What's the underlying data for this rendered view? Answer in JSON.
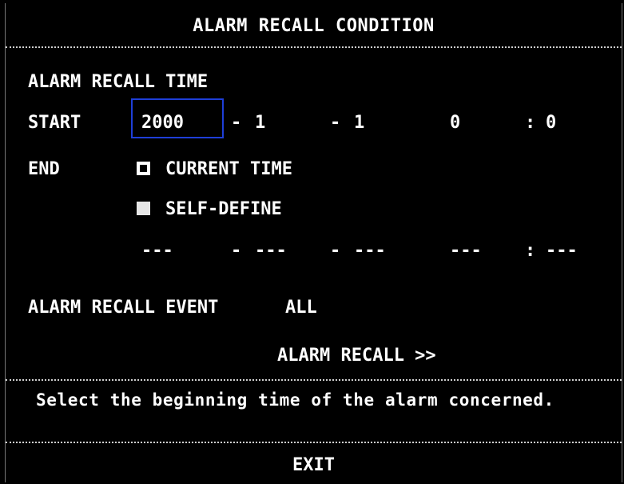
{
  "title": "ALARM RECALL CONDITION",
  "recall_time": {
    "heading": "ALARM RECALL TIME",
    "start_label": "START",
    "start": {
      "year": "2000",
      "sep1": "-",
      "month": "1",
      "sep2": "-",
      "day": "1",
      "hour": "0",
      "colon": ":",
      "minute": "0"
    },
    "end_label": "END",
    "options": [
      {
        "label": "CURRENT TIME",
        "selected": true
      },
      {
        "label": "SELF-DEFINE",
        "selected": false
      }
    ],
    "end_custom": {
      "year": "---",
      "sep1": "-",
      "month": "---",
      "sep2": "-",
      "day": "---",
      "hour": "---",
      "colon": ":",
      "minute": "---"
    }
  },
  "recall_event": {
    "label": "ALARM RECALL EVENT",
    "value": "ALL"
  },
  "recall_button": "ALARM RECALL >>",
  "help_text": "Select the beginning time of the alarm concerned.",
  "exit_label": "EXIT",
  "colors": {
    "background": "#000000",
    "text": "#ffffff",
    "focus": "#1e3fd8"
  }
}
